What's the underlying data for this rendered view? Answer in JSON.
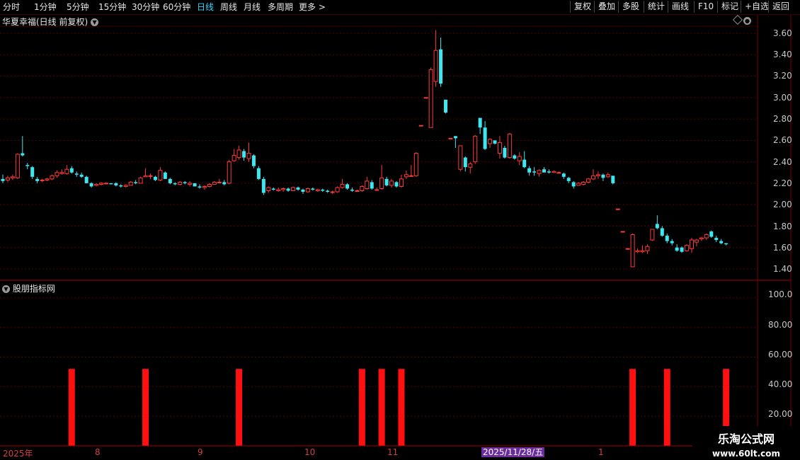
{
  "toolbar": {
    "periods": [
      "分时",
      "1分钟",
      "5分钟",
      "15分钟",
      "30分钟",
      "60分钟",
      "日线",
      "周线",
      "月线",
      "多周期",
      "更多 >"
    ],
    "active_period": "日线",
    "right_buttons": [
      "复权",
      "叠加",
      "多股",
      "统计",
      "画线",
      "F10",
      "标记",
      "+自选",
      "返回"
    ]
  },
  "chart": {
    "title": "华夏幸福(日线 前复权)",
    "y_ticks": [
      "3.60",
      "3.40",
      "3.20",
      "3.00",
      "2.80",
      "2.60",
      "2.40",
      "2.20",
      "2.00",
      "1.80",
      "1.60",
      "1.40"
    ]
  },
  "indicator": {
    "title": "股朋指标网",
    "y_ticks": [
      "100.0",
      "80.00",
      "60.00",
      "40.00",
      "20.00"
    ]
  },
  "xaxis": {
    "labels": [
      "2025年",
      "8",
      "9",
      "10",
      "11",
      "1"
    ],
    "cursor_date": "2025/11/28/五"
  },
  "watermark": {
    "line1": "乐淘公式网",
    "line2": "www.60lt.com"
  },
  "colors": {
    "up": "#ff3a3a",
    "down": "#3ee6f0",
    "grid": "#5a0000",
    "signal": "#ff1010"
  },
  "chart_data": {
    "type": "candlestick",
    "price_range": [
      1.35,
      3.7
    ],
    "indicator_range": [
      0,
      110
    ],
    "candles": [
      [
        2.24,
        2.28,
        2.2,
        2.22
      ],
      [
        2.23,
        2.27,
        2.21,
        2.25
      ],
      [
        2.25,
        2.28,
        2.23,
        2.26
      ],
      [
        2.25,
        2.48,
        2.24,
        2.47
      ],
      [
        2.48,
        2.64,
        2.45,
        2.46
      ],
      [
        2.37,
        2.39,
        2.33,
        2.36
      ],
      [
        2.35,
        2.36,
        2.24,
        2.26
      ],
      [
        2.24,
        2.26,
        2.2,
        2.22
      ],
      [
        2.23,
        2.24,
        2.21,
        2.23
      ],
      [
        2.23,
        2.25,
        2.22,
        2.24
      ],
      [
        2.24,
        2.28,
        2.23,
        2.27
      ],
      [
        2.27,
        2.32,
        2.25,
        2.3
      ],
      [
        2.29,
        2.33,
        2.28,
        2.3
      ],
      [
        2.29,
        2.37,
        2.28,
        2.33
      ],
      [
        2.34,
        2.36,
        2.29,
        2.3
      ],
      [
        2.29,
        2.31,
        2.26,
        2.28
      ],
      [
        2.28,
        2.3,
        2.25,
        2.26
      ],
      [
        2.26,
        2.27,
        2.2,
        2.2
      ],
      [
        2.2,
        2.21,
        2.16,
        2.17
      ],
      [
        2.18,
        2.2,
        2.17,
        2.19
      ],
      [
        2.19,
        2.21,
        2.18,
        2.2
      ],
      [
        2.2,
        2.21,
        2.19,
        2.2
      ],
      [
        2.2,
        2.2,
        2.19,
        2.19
      ],
      [
        2.2,
        2.21,
        2.17,
        2.18
      ],
      [
        2.18,
        2.19,
        2.16,
        2.17
      ],
      [
        2.17,
        2.19,
        2.16,
        2.18
      ],
      [
        2.18,
        2.22,
        2.18,
        2.21
      ],
      [
        2.21,
        2.23,
        2.19,
        2.2
      ],
      [
        2.2,
        2.26,
        2.2,
        2.25
      ],
      [
        2.26,
        2.34,
        2.26,
        2.27
      ],
      [
        2.27,
        2.29,
        2.24,
        2.27
      ],
      [
        2.26,
        2.27,
        2.22,
        2.23
      ],
      [
        2.23,
        2.35,
        2.22,
        2.32
      ],
      [
        2.3,
        2.31,
        2.24,
        2.24
      ],
      [
        2.24,
        2.25,
        2.19,
        2.2
      ],
      [
        2.2,
        2.21,
        2.18,
        2.19
      ],
      [
        2.19,
        2.22,
        2.18,
        2.21
      ],
      [
        2.21,
        2.22,
        2.19,
        2.2
      ],
      [
        2.19,
        2.22,
        2.17,
        2.2
      ],
      [
        2.2,
        2.2,
        2.17,
        2.17
      ],
      [
        2.17,
        2.19,
        2.15,
        2.16
      ],
      [
        2.16,
        2.18,
        2.14,
        2.17
      ],
      [
        2.17,
        2.2,
        2.16,
        2.19
      ],
      [
        2.19,
        2.22,
        2.19,
        2.21
      ],
      [
        2.21,
        2.24,
        2.2,
        2.21
      ],
      [
        2.21,
        2.23,
        2.18,
        2.19
      ],
      [
        2.2,
        2.42,
        2.19,
        2.4
      ],
      [
        2.41,
        2.52,
        2.4,
        2.46
      ],
      [
        2.44,
        2.55,
        2.42,
        2.51
      ],
      [
        2.5,
        2.52,
        2.41,
        2.44
      ],
      [
        2.43,
        2.58,
        2.4,
        2.48
      ],
      [
        2.46,
        2.47,
        2.34,
        2.36
      ],
      [
        2.34,
        2.36,
        2.23,
        2.24
      ],
      [
        2.24,
        2.26,
        2.09,
        2.11
      ],
      [
        2.13,
        2.17,
        2.11,
        2.16
      ],
      [
        2.15,
        2.16,
        2.13,
        2.14
      ],
      [
        2.13,
        2.16,
        2.12,
        2.14
      ],
      [
        2.14,
        2.16,
        2.12,
        2.15
      ],
      [
        2.15,
        2.16,
        2.12,
        2.13
      ],
      [
        2.13,
        2.17,
        2.13,
        2.16
      ],
      [
        2.16,
        2.17,
        2.13,
        2.14
      ],
      [
        2.14,
        2.15,
        2.1,
        2.12
      ],
      [
        2.12,
        2.16,
        2.11,
        2.15
      ],
      [
        2.15,
        2.16,
        2.13,
        2.14
      ],
      [
        2.13,
        2.15,
        2.12,
        2.14
      ],
      [
        2.14,
        2.15,
        2.12,
        2.13
      ],
      [
        2.13,
        2.14,
        2.11,
        2.12
      ],
      [
        2.12,
        2.13,
        2.1,
        2.12
      ],
      [
        2.12,
        2.17,
        2.11,
        2.16
      ],
      [
        2.16,
        2.24,
        2.15,
        2.19
      ],
      [
        2.19,
        2.2,
        2.14,
        2.15
      ],
      [
        2.14,
        2.16,
        2.12,
        2.13
      ],
      [
        2.13,
        2.14,
        2.12,
        2.13
      ],
      [
        2.13,
        2.18,
        2.12,
        2.17
      ],
      [
        2.15,
        2.26,
        2.14,
        2.22
      ],
      [
        2.21,
        2.23,
        2.14,
        2.15
      ],
      [
        2.14,
        2.16,
        2.13,
        2.14
      ],
      [
        2.15,
        2.37,
        2.14,
        2.25
      ],
      [
        2.24,
        2.26,
        2.17,
        2.18
      ],
      [
        2.18,
        2.24,
        2.16,
        2.22
      ],
      [
        2.21,
        2.22,
        2.16,
        2.17
      ],
      [
        2.17,
        2.28,
        2.16,
        2.24
      ],
      [
        2.26,
        2.32,
        2.24,
        2.28
      ],
      [
        2.27,
        2.37,
        2.26,
        2.27
      ],
      [
        2.27,
        2.49,
        2.26,
        2.48
      ],
      [
        2.74,
        2.74,
        2.74,
        2.74
      ],
      [
        3.0,
        3.0,
        3.0,
        3.0
      ],
      [
        2.72,
        3.28,
        2.72,
        3.26
      ],
      [
        3.15,
        3.63,
        3.1,
        3.44
      ],
      [
        3.45,
        3.56,
        3.1,
        3.13
      ],
      [
        2.98,
        2.98,
        2.85,
        2.86
      ],
      [
        2.62,
        2.62,
        2.62,
        2.62
      ],
      [
        2.64,
        2.64,
        2.53,
        2.62
      ],
      [
        2.33,
        2.53,
        2.31,
        2.55
      ],
      [
        2.44,
        2.45,
        2.31,
        2.35
      ],
      [
        2.35,
        2.4,
        2.29,
        2.38
      ],
      [
        2.4,
        2.65,
        2.38,
        2.64
      ],
      [
        2.81,
        2.81,
        2.66,
        2.72
      ],
      [
        2.72,
        2.78,
        2.51,
        2.52
      ],
      [
        2.57,
        2.62,
        2.53,
        2.61
      ],
      [
        2.6,
        2.6,
        2.56,
        2.57
      ],
      [
        2.48,
        2.64,
        2.43,
        2.58
      ],
      [
        2.53,
        2.55,
        2.43,
        2.44
      ],
      [
        2.44,
        2.67,
        2.43,
        2.66
      ],
      [
        2.46,
        2.47,
        2.42,
        2.43
      ],
      [
        2.41,
        2.49,
        2.37,
        2.45
      ],
      [
        2.42,
        2.5,
        2.34,
        2.35
      ],
      [
        2.34,
        2.36,
        2.27,
        2.3
      ],
      [
        2.31,
        2.35,
        2.27,
        2.3
      ],
      [
        2.29,
        2.33,
        2.26,
        2.32
      ],
      [
        2.33,
        2.35,
        2.31,
        2.3
      ],
      [
        2.31,
        2.33,
        2.29,
        2.3
      ],
      [
        2.3,
        2.32,
        2.3,
        2.31
      ],
      [
        2.3,
        2.31,
        2.29,
        2.3
      ],
      [
        2.29,
        2.3,
        2.24,
        2.26
      ],
      [
        2.25,
        2.26,
        2.2,
        2.22
      ],
      [
        2.21,
        2.22,
        2.15,
        2.17
      ],
      [
        2.18,
        2.21,
        2.18,
        2.2
      ],
      [
        2.19,
        2.22,
        2.18,
        2.21
      ],
      [
        2.21,
        2.25,
        2.2,
        2.24
      ],
      [
        2.24,
        2.33,
        2.23,
        2.27
      ],
      [
        2.27,
        2.31,
        2.24,
        2.28
      ],
      [
        2.28,
        2.29,
        2.22,
        2.25
      ],
      [
        2.26,
        2.3,
        2.25,
        2.28
      ],
      [
        2.27,
        2.27,
        2.19,
        2.2
      ],
      [
        1.96,
        1.96,
        1.96,
        1.96
      ],
      [
        1.75,
        1.75,
        1.75,
        1.75
      ],
      [
        1.59,
        1.59,
        1.59,
        1.59
      ],
      [
        1.42,
        1.73,
        1.42,
        1.72
      ],
      [
        1.56,
        1.59,
        1.55,
        1.57
      ],
      [
        1.56,
        1.62,
        1.55,
        1.57
      ],
      [
        1.57,
        1.63,
        1.54,
        1.61
      ],
      [
        1.67,
        1.77,
        1.66,
        1.77
      ],
      [
        1.82,
        1.9,
        1.77,
        1.78
      ],
      [
        1.78,
        1.8,
        1.7,
        1.71
      ],
      [
        1.71,
        1.73,
        1.64,
        1.66
      ],
      [
        1.66,
        1.68,
        1.62,
        1.64
      ],
      [
        1.6,
        1.63,
        1.56,
        1.57
      ],
      [
        1.6,
        1.61,
        1.55,
        1.56
      ],
      [
        1.57,
        1.63,
        1.56,
        1.62
      ],
      [
        1.59,
        1.69,
        1.55,
        1.67
      ],
      [
        1.65,
        1.68,
        1.61,
        1.67
      ],
      [
        1.68,
        1.7,
        1.66,
        1.69
      ],
      [
        1.69,
        1.73,
        1.67,
        1.72
      ],
      [
        1.75,
        1.76,
        1.69,
        1.7
      ],
      [
        1.69,
        1.71,
        1.65,
        1.67
      ],
      [
        1.66,
        1.68,
        1.63,
        1.64
      ],
      [
        1.64,
        1.64,
        1.62,
        1.63
      ]
    ],
    "signals": [
      {
        "index": 14,
        "value": 52
      },
      {
        "index": 29,
        "value": 52
      },
      {
        "index": 48,
        "value": 52
      },
      {
        "index": 73,
        "value": 52
      },
      {
        "index": 77,
        "value": 52
      },
      {
        "index": 81,
        "value": 52
      },
      {
        "index": 128,
        "value": 52
      },
      {
        "index": 135,
        "value": 52
      },
      {
        "index": 147,
        "value": 52
      }
    ]
  }
}
